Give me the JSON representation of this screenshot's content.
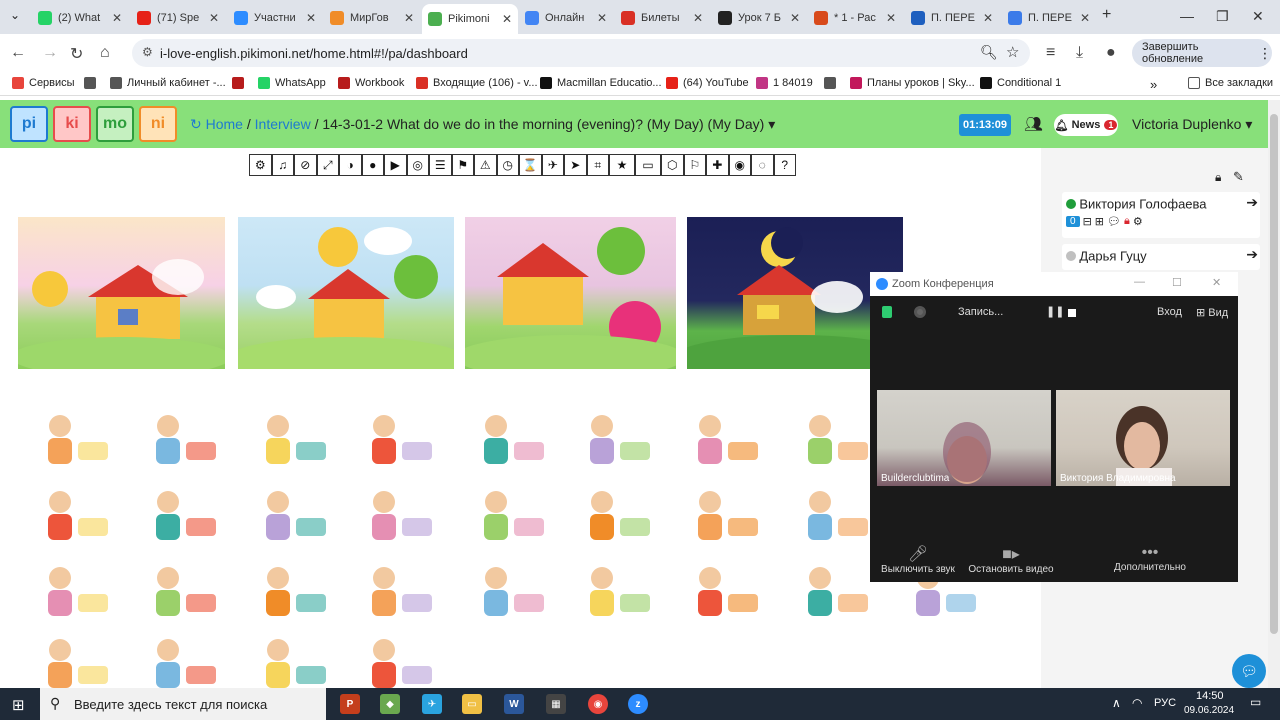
{
  "browser": {
    "tabs": [
      {
        "label": "(2) What",
        "icon": "whatsapp-icon",
        "color": "#25d366",
        "active": false
      },
      {
        "label": "(71) Spe",
        "icon": "youtube-icon",
        "color": "#e62117",
        "active": false
      },
      {
        "label": "Участни",
        "icon": "zoom-icon",
        "color": "#2d8cff",
        "active": false
      },
      {
        "label": "МирГов",
        "icon": "mirgov-icon",
        "color": "#f08c28",
        "active": false
      },
      {
        "label": "Pikimoni",
        "icon": "pikimoni-icon",
        "color": "#4caf50",
        "active": true
      },
      {
        "label": "Онлайн",
        "icon": "chrome-icon",
        "color": "#4285f4",
        "active": false
      },
      {
        "label": "Билеты",
        "icon": "gmail-icon",
        "color": "#d93025",
        "active": false
      },
      {
        "label": "Урок 7 Б",
        "icon": "doc-icon",
        "color": "#222222",
        "active": false
      },
      {
        "label": "* 1 - Рас",
        "icon": "office-icon",
        "color": "#d84a1b",
        "active": false
      },
      {
        "label": "П. ПЕРЕ",
        "icon": "edge-icon",
        "color": "#1e5fbf",
        "active": false
      },
      {
        "label": "П. ПЕРЕ",
        "icon": "docs-icon",
        "color": "#3b7be9",
        "active": false
      }
    ],
    "url": "i-love-english.pikimoni.net/home.html#!/pa/dashboard",
    "update_label": "Завершить обновление",
    "bookmarks": [
      {
        "label": "Сервисы",
        "color": "#e8453c"
      },
      {
        "label": "",
        "color": "#555555"
      },
      {
        "label": "Личный кабинет -...",
        "color": "#555555"
      },
      {
        "label": "",
        "color": "#b71c1c"
      },
      {
        "label": "WhatsApp",
        "color": "#25d366"
      },
      {
        "label": "Workbook",
        "color": "#b71c1c"
      },
      {
        "label": "Входящие (106) - v...",
        "color": "#d93025"
      },
      {
        "label": "Macmillan Educatio...",
        "color": "#111111"
      },
      {
        "label": "(64) YouTube",
        "color": "#e62117"
      },
      {
        "label": "1 84019",
        "color": "#c13584"
      },
      {
        "label": "",
        "color": "#555555"
      },
      {
        "label": "Планы уроков | Sky...",
        "color": "#c2185b"
      },
      {
        "label": "Conditional 1",
        "color": "#111111"
      }
    ],
    "all_bookmarks_label": "Все закладки"
  },
  "site": {
    "logo": [
      "pi",
      "ki",
      "mo",
      "ni"
    ],
    "logo_colors": [
      "#1e7ad0",
      "#e74c4c",
      "#2e9e3c",
      "#f08c28"
    ],
    "breadcrumb_home": "Home",
    "breadcrumb_interview": "Interview",
    "breadcrumb_current": "14-3-01-2 What do we do in the morning (evening)? (My Day) (My Day)",
    "timer": "01:13:09",
    "news_label": "News",
    "news_count": "1",
    "user_name": "Victoria Duplenko"
  },
  "toolbar": {
    "tools": [
      "⚙",
      "♫",
      "⊘",
      "⤢",
      "◑",
      "●",
      "▶",
      "◎",
      "☰",
      "⚑",
      "⚠",
      "◷",
      "⌛",
      "✈",
      "➤",
      "⌗",
      "★",
      "▭",
      "⬡",
      "⚐",
      "✚",
      "◉",
      "◌",
      "?"
    ]
  },
  "right_panel": {
    "students": [
      {
        "name": "Виктория Голофаева",
        "status_color": "#1f9d3a",
        "score": "0"
      },
      {
        "name": "Дарья Гуцу",
        "status_color": "#c0c0c0"
      }
    ]
  },
  "zoom": {
    "title": "Zoom Конференция",
    "recording_label": "Запись...",
    "enter_label": "Вход",
    "view_label": "Вид",
    "participants": [
      {
        "name": "Builderclubtima"
      },
      {
        "name": "Виктория Владимировна"
      }
    ],
    "controls": [
      {
        "label": "Выключить звук",
        "icon": "microphone-icon"
      },
      {
        "label": "Остановить видео",
        "icon": "video-camera-icon"
      },
      {
        "label": "Дополнительно",
        "icon": "more-icon"
      }
    ]
  },
  "taskbar": {
    "search_placeholder": "Введите здесь текст для поиска",
    "lang": "РУС",
    "time": "14:50",
    "date": "09.06.2024"
  }
}
